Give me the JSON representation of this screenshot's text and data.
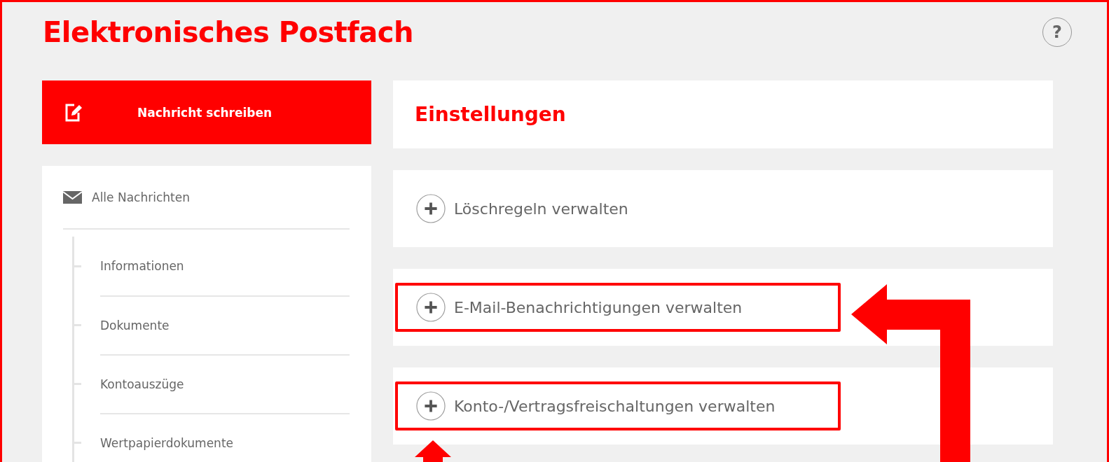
{
  "page": {
    "title": "Elektronisches Postfach",
    "help_button": "?"
  },
  "sidebar": {
    "compose_button": "Nachricht schreiben",
    "nav": [
      {
        "label": "Alle Nachrichten",
        "children": [
          {
            "label": "Informationen"
          },
          {
            "label": "Dokumente"
          },
          {
            "label": "Kontoauszüge"
          },
          {
            "label": "Wertpapierdokumente"
          }
        ]
      }
    ]
  },
  "settings": {
    "title": "Einstellungen",
    "sections": [
      {
        "label": "Löschregeln verwalten",
        "expanded": false,
        "highlighted": false
      },
      {
        "label": "E-Mail-Benachrichtigungen verwalten",
        "expanded": false,
        "highlighted": true
      },
      {
        "label": "Konto-/Vertragsfreischaltungen verwalten",
        "expanded": false,
        "highlighted": true
      }
    ]
  }
}
